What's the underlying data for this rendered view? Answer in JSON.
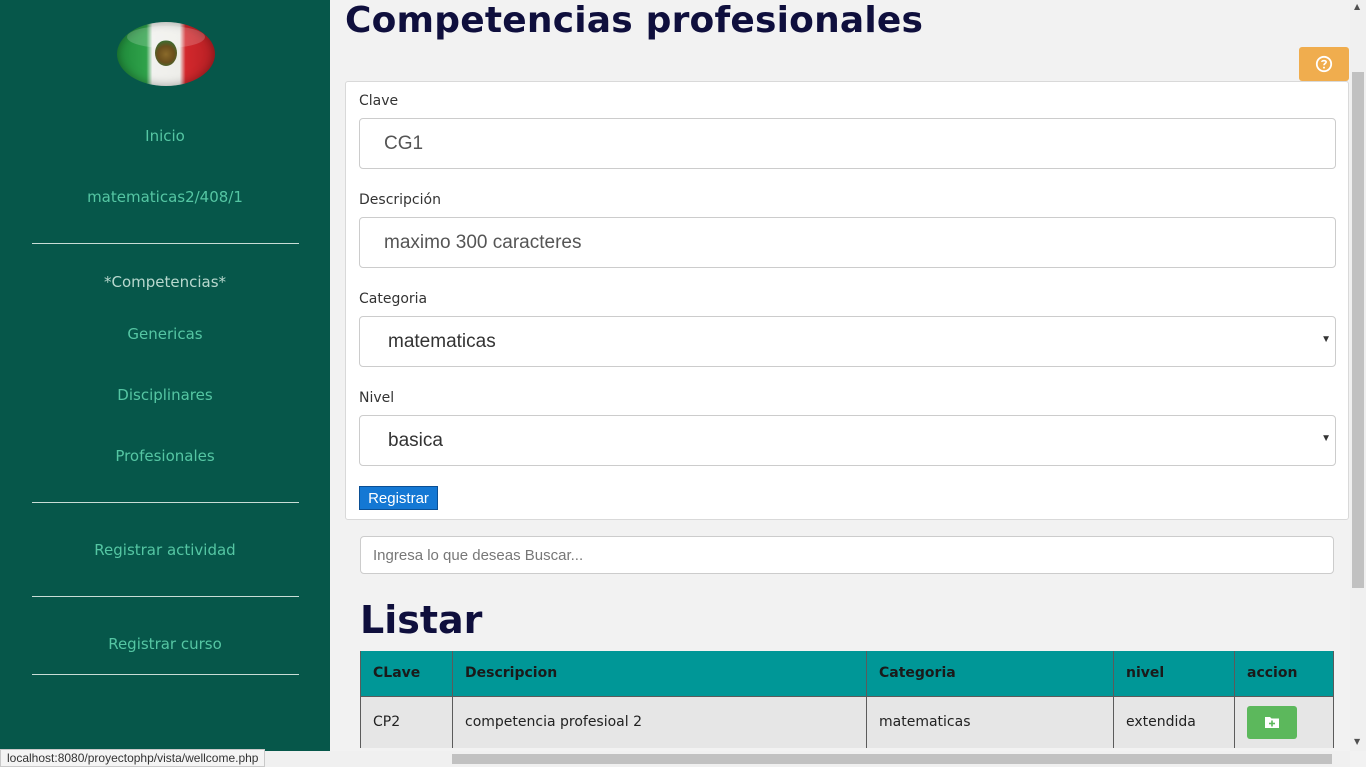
{
  "sidebar": {
    "items": {
      "inicio": "Inicio",
      "course": "matematicas2/408/1",
      "competencias": "*Competencias*",
      "genericas": "Genericas",
      "disciplinares": "Disciplinares",
      "profesionales": "Profesionales",
      "registrar_actividad": "Registrar actividad",
      "registrar_curso": "Registrar curso"
    },
    "colors": {
      "background": "#06574a",
      "link": "#55c6a3"
    }
  },
  "header": {
    "title": "Competencias profesionales"
  },
  "form": {
    "clave_label": "Clave",
    "clave_value": "CG1",
    "descripcion_label": "Descripción",
    "descripcion_placeholder": "maximo 300 caracteres",
    "categoria_label": "Categoria",
    "categoria_value": "matematicas",
    "nivel_label": "Nivel",
    "nivel_value": "basica",
    "submit_label": "Registrar"
  },
  "search": {
    "placeholder": "Ingresa lo que deseas Buscar..."
  },
  "list": {
    "title": "Listar",
    "columns": [
      "CLave",
      "Descripcion",
      "Categoria",
      "nivel",
      "accion"
    ],
    "rows": [
      {
        "clave": "CP2",
        "descripcion": "competencia profesioal 2",
        "categoria": "matematicas",
        "nivel": "extendida",
        "accion_icon": "folder-plus-icon"
      }
    ]
  },
  "icons": {
    "help": "question-circle-icon",
    "add": "folder-plus-icon"
  },
  "status_bar": {
    "url": "localhost:8080/proyectophp/vista/wellcome.php"
  },
  "theme": {
    "table_header": "#009797",
    "help_button": "#f0ad4e",
    "add_button": "#5cb85c",
    "submit_button": "#1478d4"
  }
}
